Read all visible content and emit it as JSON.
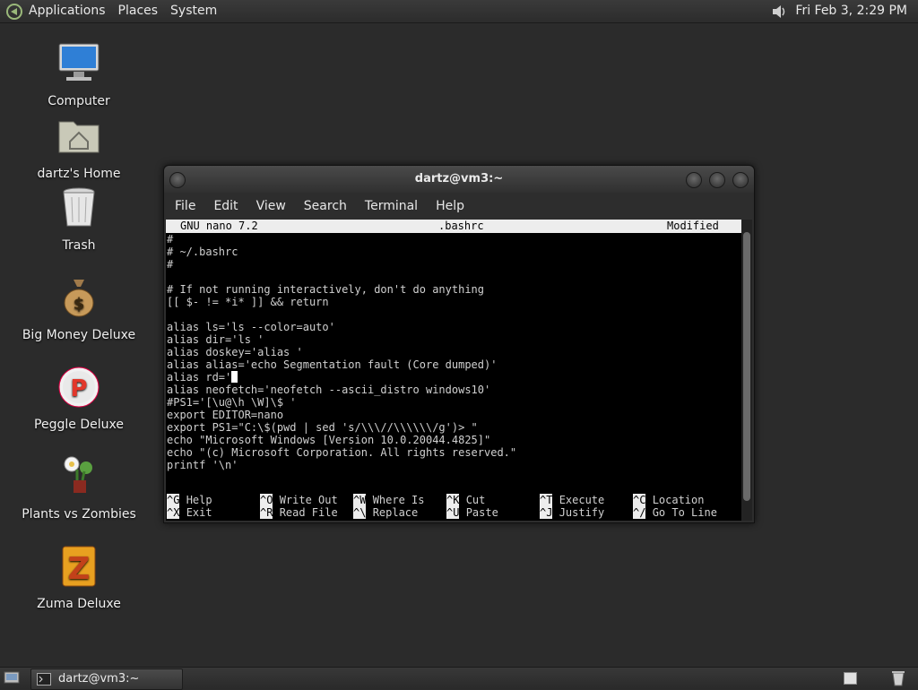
{
  "top_panel": {
    "menus": [
      "Applications",
      "Places",
      "System"
    ],
    "clock": "Fri Feb  3,  2:29 PM",
    "logo_icon": "gnome-foot-icon",
    "volume_icon": "speaker-icon"
  },
  "desktop_icons": [
    {
      "label": "Computer",
      "icon": "computer-icon"
    },
    {
      "label": "dartz's Home",
      "icon": "home-folder-icon"
    },
    {
      "label": "Trash",
      "icon": "trash-icon"
    },
    {
      "label": "Big Money Deluxe",
      "icon": "money-bag-icon"
    },
    {
      "label": "Peggle Deluxe",
      "icon": "peggle-icon"
    },
    {
      "label": "Plants vs Zombies",
      "icon": "plant-icon"
    },
    {
      "label": "Zuma Deluxe",
      "icon": "zuma-icon"
    }
  ],
  "window": {
    "title": "dartz@vm3:~",
    "menu": [
      "File",
      "Edit",
      "View",
      "Search",
      "Terminal",
      "Help"
    ]
  },
  "nano": {
    "version": "GNU nano 7.2",
    "filename": ".bashrc",
    "status": "Modified",
    "lines": [
      "#",
      "# ~/.bashrc",
      "#",
      "",
      "# If not running interactively, don't do anything",
      "[[ $- != *i* ]] && return",
      "",
      "alias ls='ls --color=auto'",
      "alias dir='ls '",
      "alias doskey='alias '",
      "alias alias='echo Segmentation fault (Core dumped)'",
      "alias rd='",
      "alias neofetch='neofetch --ascii_distro windows10'",
      "#PS1='[\\u@\\h \\W]\\$ '",
      "export EDITOR=nano",
      "export PS1=\"C:\\$(pwd | sed 's/\\\\\\//\\\\\\\\\\\\/g')> \"",
      "echo \"Microsoft Windows [Version 10.0.20044.4825]\"",
      "echo \"(c) Microsoft Corporation. All rights reserved.\"",
      "printf '\\n'"
    ],
    "shortcuts_row1": [
      {
        "key": "^G",
        "label": "Help"
      },
      {
        "key": "^O",
        "label": "Write Out"
      },
      {
        "key": "^W",
        "label": "Where Is"
      },
      {
        "key": "^K",
        "label": "Cut"
      },
      {
        "key": "^T",
        "label": "Execute"
      },
      {
        "key": "^C",
        "label": "Location"
      }
    ],
    "shortcuts_row2": [
      {
        "key": "^X",
        "label": "Exit"
      },
      {
        "key": "^R",
        "label": "Read File"
      },
      {
        "key": "^\\",
        "label": "Replace"
      },
      {
        "key": "^U",
        "label": "Paste"
      },
      {
        "key": "^J",
        "label": "Justify"
      },
      {
        "key": "^/",
        "label": "Go To Line"
      }
    ]
  },
  "bottom_panel": {
    "task_label": "dartz@vm3:~"
  }
}
